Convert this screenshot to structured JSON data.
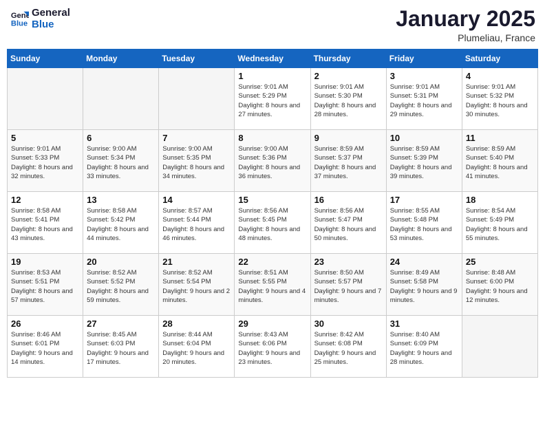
{
  "header": {
    "logo_line1": "General",
    "logo_line2": "Blue",
    "title": "January 2025",
    "subtitle": "Plumeliau, France"
  },
  "weekdays": [
    "Sunday",
    "Monday",
    "Tuesday",
    "Wednesday",
    "Thursday",
    "Friday",
    "Saturday"
  ],
  "weeks": [
    [
      {
        "day": "",
        "info": ""
      },
      {
        "day": "",
        "info": ""
      },
      {
        "day": "",
        "info": ""
      },
      {
        "day": "1",
        "info": "Sunrise: 9:01 AM\nSunset: 5:29 PM\nDaylight: 8 hours and 27 minutes."
      },
      {
        "day": "2",
        "info": "Sunrise: 9:01 AM\nSunset: 5:30 PM\nDaylight: 8 hours and 28 minutes."
      },
      {
        "day": "3",
        "info": "Sunrise: 9:01 AM\nSunset: 5:31 PM\nDaylight: 8 hours and 29 minutes."
      },
      {
        "day": "4",
        "info": "Sunrise: 9:01 AM\nSunset: 5:32 PM\nDaylight: 8 hours and 30 minutes."
      }
    ],
    [
      {
        "day": "5",
        "info": "Sunrise: 9:01 AM\nSunset: 5:33 PM\nDaylight: 8 hours and 32 minutes."
      },
      {
        "day": "6",
        "info": "Sunrise: 9:00 AM\nSunset: 5:34 PM\nDaylight: 8 hours and 33 minutes."
      },
      {
        "day": "7",
        "info": "Sunrise: 9:00 AM\nSunset: 5:35 PM\nDaylight: 8 hours and 34 minutes."
      },
      {
        "day": "8",
        "info": "Sunrise: 9:00 AM\nSunset: 5:36 PM\nDaylight: 8 hours and 36 minutes."
      },
      {
        "day": "9",
        "info": "Sunrise: 8:59 AM\nSunset: 5:37 PM\nDaylight: 8 hours and 37 minutes."
      },
      {
        "day": "10",
        "info": "Sunrise: 8:59 AM\nSunset: 5:39 PM\nDaylight: 8 hours and 39 minutes."
      },
      {
        "day": "11",
        "info": "Sunrise: 8:59 AM\nSunset: 5:40 PM\nDaylight: 8 hours and 41 minutes."
      }
    ],
    [
      {
        "day": "12",
        "info": "Sunrise: 8:58 AM\nSunset: 5:41 PM\nDaylight: 8 hours and 43 minutes."
      },
      {
        "day": "13",
        "info": "Sunrise: 8:58 AM\nSunset: 5:42 PM\nDaylight: 8 hours and 44 minutes."
      },
      {
        "day": "14",
        "info": "Sunrise: 8:57 AM\nSunset: 5:44 PM\nDaylight: 8 hours and 46 minutes."
      },
      {
        "day": "15",
        "info": "Sunrise: 8:56 AM\nSunset: 5:45 PM\nDaylight: 8 hours and 48 minutes."
      },
      {
        "day": "16",
        "info": "Sunrise: 8:56 AM\nSunset: 5:47 PM\nDaylight: 8 hours and 50 minutes."
      },
      {
        "day": "17",
        "info": "Sunrise: 8:55 AM\nSunset: 5:48 PM\nDaylight: 8 hours and 53 minutes."
      },
      {
        "day": "18",
        "info": "Sunrise: 8:54 AM\nSunset: 5:49 PM\nDaylight: 8 hours and 55 minutes."
      }
    ],
    [
      {
        "day": "19",
        "info": "Sunrise: 8:53 AM\nSunset: 5:51 PM\nDaylight: 8 hours and 57 minutes."
      },
      {
        "day": "20",
        "info": "Sunrise: 8:52 AM\nSunset: 5:52 PM\nDaylight: 8 hours and 59 minutes."
      },
      {
        "day": "21",
        "info": "Sunrise: 8:52 AM\nSunset: 5:54 PM\nDaylight: 9 hours and 2 minutes."
      },
      {
        "day": "22",
        "info": "Sunrise: 8:51 AM\nSunset: 5:55 PM\nDaylight: 9 hours and 4 minutes."
      },
      {
        "day": "23",
        "info": "Sunrise: 8:50 AM\nSunset: 5:57 PM\nDaylight: 9 hours and 7 minutes."
      },
      {
        "day": "24",
        "info": "Sunrise: 8:49 AM\nSunset: 5:58 PM\nDaylight: 9 hours and 9 minutes."
      },
      {
        "day": "25",
        "info": "Sunrise: 8:48 AM\nSunset: 6:00 PM\nDaylight: 9 hours and 12 minutes."
      }
    ],
    [
      {
        "day": "26",
        "info": "Sunrise: 8:46 AM\nSunset: 6:01 PM\nDaylight: 9 hours and 14 minutes."
      },
      {
        "day": "27",
        "info": "Sunrise: 8:45 AM\nSunset: 6:03 PM\nDaylight: 9 hours and 17 minutes."
      },
      {
        "day": "28",
        "info": "Sunrise: 8:44 AM\nSunset: 6:04 PM\nDaylight: 9 hours and 20 minutes."
      },
      {
        "day": "29",
        "info": "Sunrise: 8:43 AM\nSunset: 6:06 PM\nDaylight: 9 hours and 23 minutes."
      },
      {
        "day": "30",
        "info": "Sunrise: 8:42 AM\nSunset: 6:08 PM\nDaylight: 9 hours and 25 minutes."
      },
      {
        "day": "31",
        "info": "Sunrise: 8:40 AM\nSunset: 6:09 PM\nDaylight: 9 hours and 28 minutes."
      },
      {
        "day": "",
        "info": ""
      }
    ]
  ]
}
